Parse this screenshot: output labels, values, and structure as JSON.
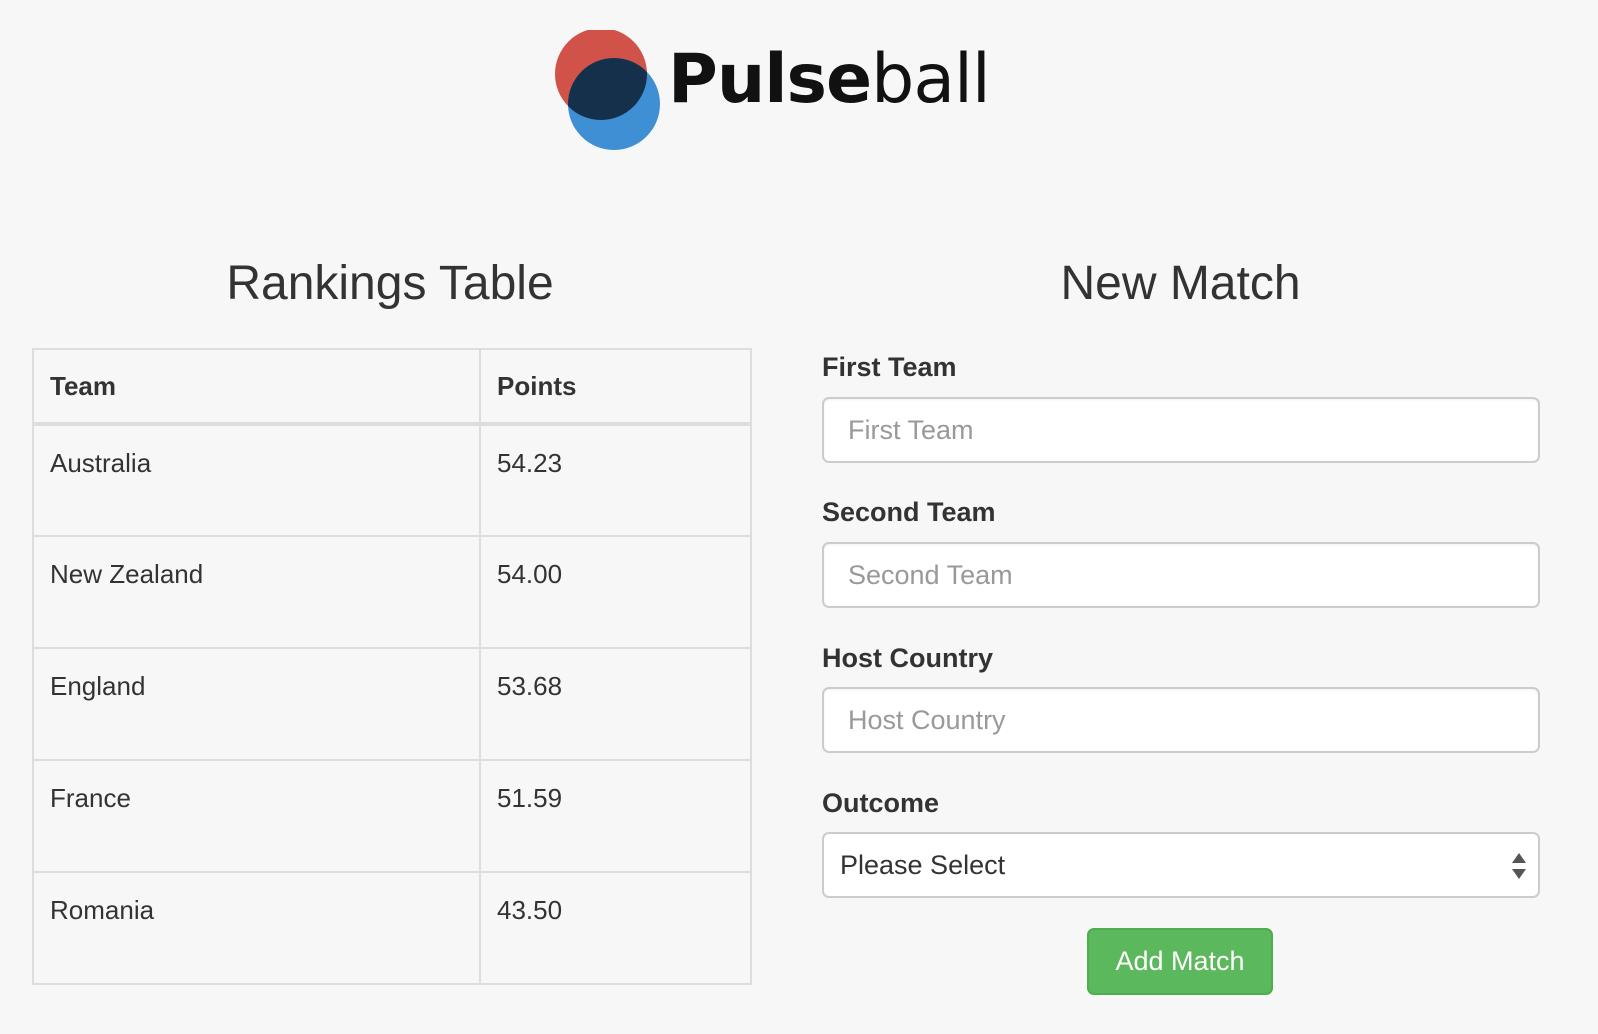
{
  "brand": {
    "name_bold": "Pulse",
    "name_light": "ball",
    "logo_colors": {
      "red": "#d05248",
      "blue": "#3f8fd4",
      "overlap": "#15304b"
    }
  },
  "rankings": {
    "title": "Rankings Table",
    "columns": [
      "Team",
      "Points"
    ],
    "rows": [
      {
        "team": "Australia",
        "points": "54.23"
      },
      {
        "team": "New Zealand",
        "points": "54.00"
      },
      {
        "team": "England",
        "points": "53.68"
      },
      {
        "team": "France",
        "points": "51.59"
      },
      {
        "team": "Romania",
        "points": "43.50"
      }
    ]
  },
  "new_match": {
    "title": "New Match",
    "first_team": {
      "label": "First Team",
      "placeholder": "First Team",
      "value": ""
    },
    "second_team": {
      "label": "Second Team",
      "placeholder": "Second Team",
      "value": ""
    },
    "host_country": {
      "label": "Host Country",
      "placeholder": "Host Country",
      "value": ""
    },
    "outcome": {
      "label": "Outcome",
      "selected": "Please Select",
      "icon": "updown-arrows-icon"
    },
    "submit_label": "Add Match",
    "submit_color": "#5cb85c"
  }
}
